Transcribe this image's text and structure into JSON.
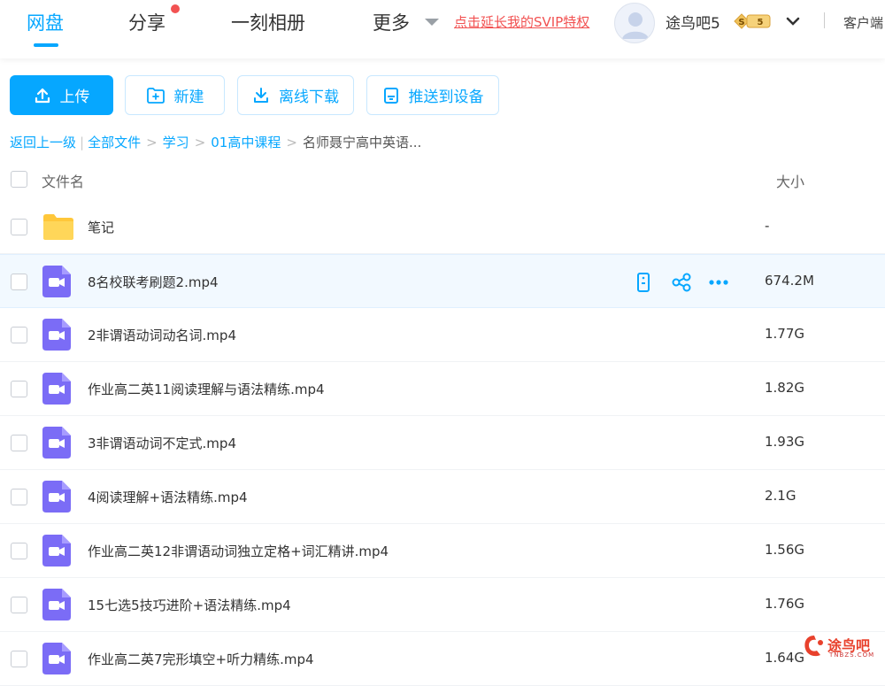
{
  "nav": {
    "tabs": [
      {
        "label": "网盘",
        "active": true
      },
      {
        "label": "分享",
        "has_dot": true
      },
      {
        "label": "一刻相册"
      },
      {
        "label": "更多"
      }
    ],
    "vip_link": "点击延长我的SVIP特权",
    "username": "途鸟吧5",
    "svip_badge": {
      "left": "S",
      "right": "5"
    },
    "client_label": "客户端"
  },
  "toolbar": {
    "upload": "上传",
    "new": "新建",
    "offline_download": "离线下载",
    "push_device": "推送到设备"
  },
  "breadcrumb": {
    "back": "返回上一级",
    "items": [
      "全部文件",
      "学习",
      "01高中课程"
    ],
    "current": "名师聂宁高中英语..."
  },
  "table": {
    "headers": {
      "name": "文件名",
      "size": "大小"
    },
    "rows": [
      {
        "name": "笔记",
        "size": "-",
        "type": "folder"
      },
      {
        "name": "8名校联考刷题2.mp4",
        "size": "674.2M",
        "type": "video",
        "hover": true
      },
      {
        "name": "2非谓语动词动名词.mp4",
        "size": "1.77G",
        "type": "video"
      },
      {
        "name": "作业高二英11阅读理解与语法精练.mp4",
        "size": "1.82G",
        "type": "video"
      },
      {
        "name": "3非谓语动词不定式.mp4",
        "size": "1.93G",
        "type": "video"
      },
      {
        "name": "4阅读理解+语法精练.mp4",
        "size": "2.1G",
        "type": "video"
      },
      {
        "name": "作业高二英12非谓语动词独立定格+词汇精讲.mp4",
        "size": "1.56G",
        "type": "video"
      },
      {
        "name": "15七选5技巧进阶+语法精练.mp4",
        "size": "1.76G",
        "type": "video"
      },
      {
        "name": "作业高二英7完形填空+听力精练.mp4",
        "size": "1.64G",
        "type": "video"
      }
    ],
    "row_actions": [
      "push-to-device-icon",
      "share-icon",
      "more-icon"
    ]
  },
  "watermark": {
    "text": "途鸟吧",
    "sub": "TNBZS.COM"
  },
  "colors": {
    "accent": "#06a7ff",
    "red": "#f25252",
    "video_icon": "#7b6cf6",
    "folder": "#ffc73a"
  }
}
